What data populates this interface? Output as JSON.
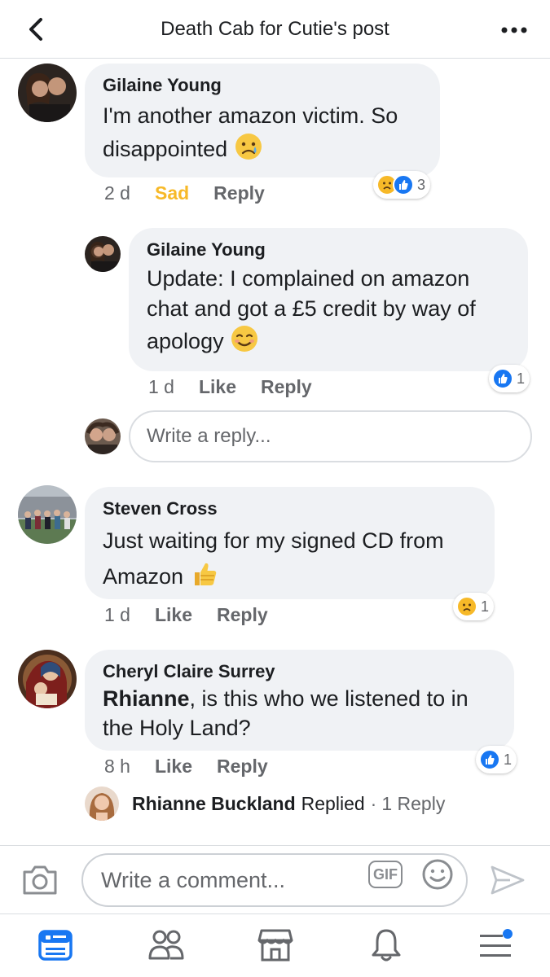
{
  "header": {
    "title": "Death Cab for Cutie's post"
  },
  "comments": [
    {
      "author": "Gilaine Young",
      "text": "I'm another amazon victim. So disappointed",
      "time": "2 d",
      "reaction_label": "Sad",
      "reply_label": "Reply",
      "reaction_count": "3"
    },
    {
      "author": "Gilaine Young",
      "text": "Update: I complained on amazon chat and got a £5 credit by way of apology",
      "time": "1 d",
      "like_label": "Like",
      "reply_label": "Reply",
      "reaction_count": "1"
    },
    {
      "author": "Steven Cross",
      "text": "Just waiting for my signed CD from Amazon",
      "time": "1 d",
      "like_label": "Like",
      "reply_label": "Reply",
      "reaction_count": "1"
    },
    {
      "author": "Cheryl Claire Surrey",
      "mention": "Rhianne",
      "text": ", is this who we listened to in the Holy Land?",
      "time": "8 h",
      "like_label": "Like",
      "reply_label": "Reply",
      "reaction_count": "1"
    }
  ],
  "write_reply": {
    "placeholder": "Write a reply..."
  },
  "replied": {
    "name": "Rhianne Buckland",
    "action": "Replied",
    "separator": "·",
    "count": "1 Reply"
  },
  "composer": {
    "placeholder": "Write a comment...",
    "gif_label": "GIF"
  },
  "colors": {
    "accent": "#1877f2",
    "sad": "#f7b928",
    "bubble": "#f0f2f5",
    "muted": "#65676b"
  },
  "icons": {
    "back": "chevron-left-icon",
    "more": "more-dots-icon",
    "camera": "camera-icon",
    "emoji": "smiley-icon",
    "send": "send-icon",
    "tabs": [
      "news-feed-icon",
      "friends-icon",
      "marketplace-icon",
      "notifications-icon",
      "menu-icon"
    ]
  }
}
